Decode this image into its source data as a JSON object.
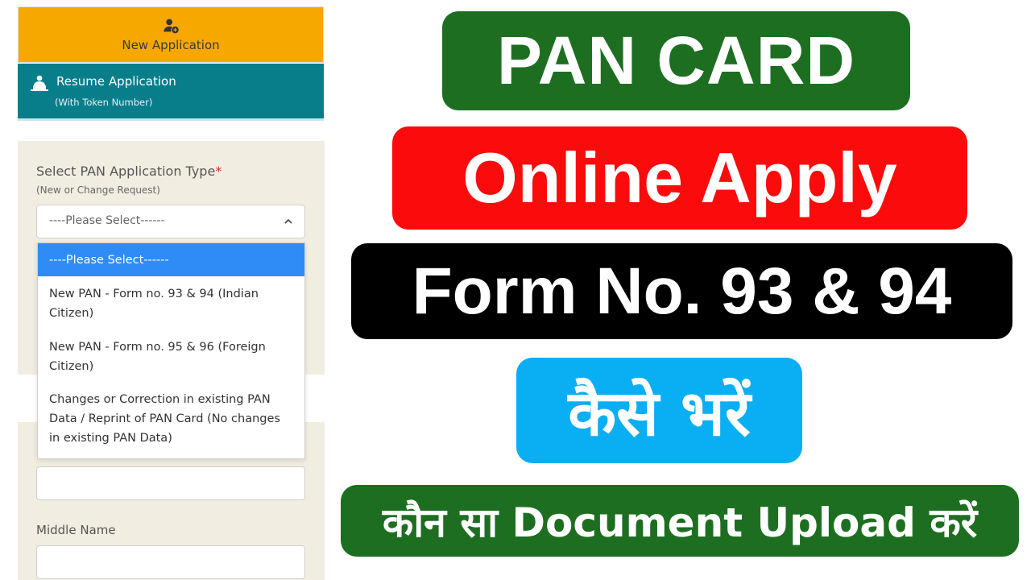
{
  "form": {
    "new_application_label": "New Application",
    "resume_application_label": "Resume Application",
    "resume_application_sub": "(With Token Number)",
    "application_type_label": "Select PAN Application Type",
    "required_mark": "*",
    "application_type_sub": "(New or Change Request)",
    "select_value": "----Please Select------",
    "options": [
      "----Please Select------",
      "New PAN - Form no. 93 & 94 (Indian Citizen)",
      "New PAN - Form no. 95 & 96 (Foreign Citizen)",
      "Changes or Correction in existing PAN Data / Reprint of PAN Card (No changes in existing PAN Data)"
    ],
    "middle_name_label": "Middle Name"
  },
  "banners": {
    "line1": "PAN CARD",
    "line2": "Online Apply",
    "line3": "Form No. 93 & 94",
    "line4": "कैसे भरें",
    "line5": "कौन सा Document Upload करें"
  },
  "colors": {
    "new_app_bg": "#f6a800",
    "resume_bg": "#087e8b",
    "panel_bg": "#f1eee1",
    "selected_option_bg": "#2f8cf6",
    "banner_green": "#1e6e21",
    "banner_red": "#fb0b0b",
    "banner_black": "#000000",
    "banner_blue": "#0aaef2"
  },
  "icons": {
    "new_application": "user-plus-icon",
    "resume_application": "person-laptop-icon",
    "select_toggle": "chevron-up-icon"
  }
}
